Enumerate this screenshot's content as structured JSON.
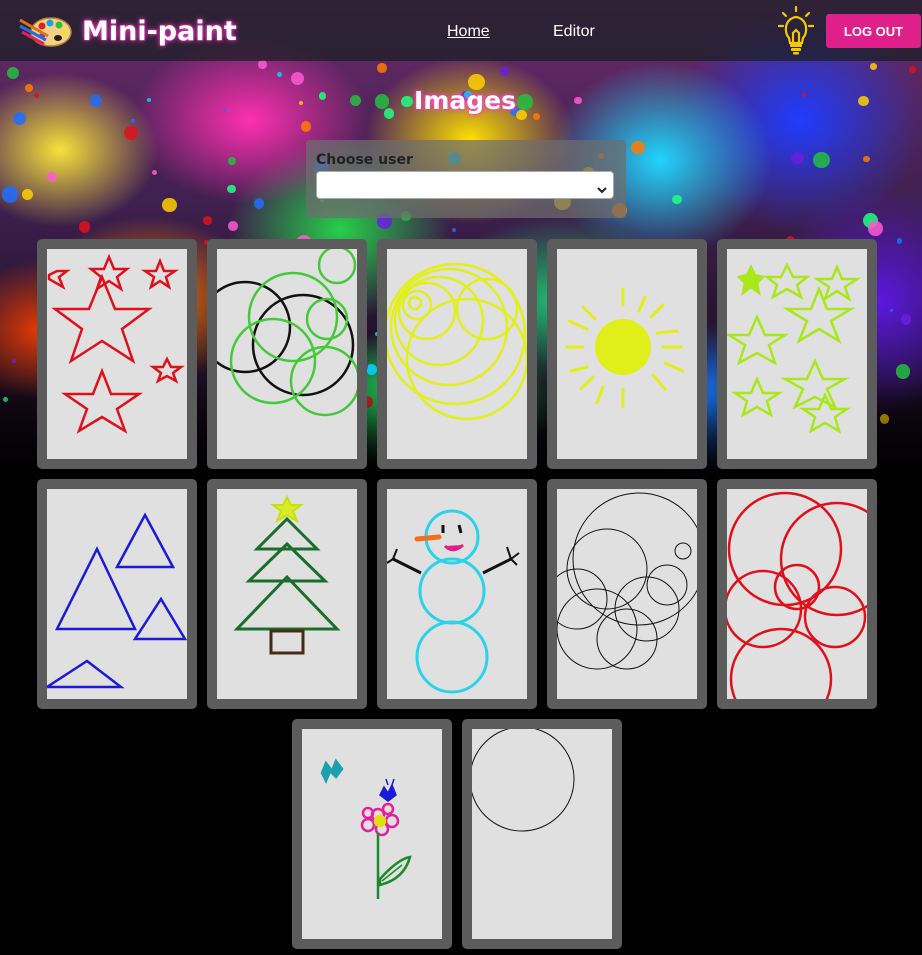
{
  "app": {
    "name": "Mini-paint",
    "logo_icon": "palette-icon",
    "brand_glow_color": "#ff3cc8"
  },
  "nav": {
    "links": [
      {
        "label": "Home",
        "active": true
      },
      {
        "label": "Editor",
        "active": false
      }
    ],
    "theme_icon": "lightbulb-icon",
    "logout_label": "LOG OUT",
    "logout_color": "#e0208a"
  },
  "page": {
    "title": "Images"
  },
  "user_filter": {
    "label": "Choose user",
    "selected_value": ""
  },
  "gallery": {
    "images": [
      {
        "subject": "red stars",
        "color": "#e0101a"
      },
      {
        "subject": "black and green circles",
        "color": "#44c93a"
      },
      {
        "subject": "yellow spiral circles",
        "color": "#e2ef1a"
      },
      {
        "subject": "yellow sun",
        "color": "#e0ef1a"
      },
      {
        "subject": "lime stars",
        "color": "#a8e81a"
      },
      {
        "subject": "blue triangles",
        "color": "#1a1ad8"
      },
      {
        "subject": "christmas tree",
        "color": "#1b6e2a"
      },
      {
        "subject": "snowman",
        "color": "#2bd3ea"
      },
      {
        "subject": "thin black circles",
        "color": "#111111"
      },
      {
        "subject": "red circles",
        "color": "#e0101a"
      },
      {
        "subject": "flower with butterflies",
        "color": "#e2209a"
      },
      {
        "subject": "single circle",
        "color": "#111111"
      }
    ]
  }
}
